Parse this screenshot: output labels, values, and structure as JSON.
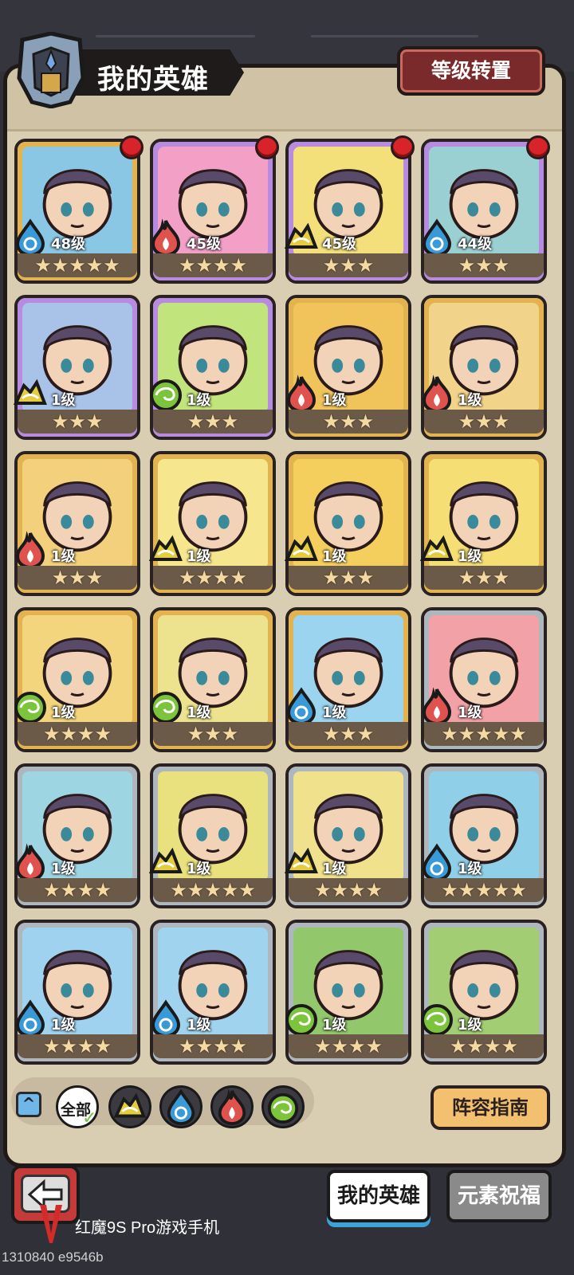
{
  "header": {
    "title": "我的英雄",
    "reset_button": "等级转置"
  },
  "heroes": [
    {
      "element": "water",
      "level": "48级",
      "stars": "★★★★★",
      "tier": "gold",
      "new": true,
      "color": "#8ac7e4"
    },
    {
      "element": "fire",
      "level": "45级",
      "stars": "★★★★",
      "tier": "purple",
      "new": true,
      "color": "#f3a0c6"
    },
    {
      "element": "earth",
      "level": "45级",
      "stars": "★★★",
      "tier": "purple",
      "new": true,
      "color": "#f4e07a"
    },
    {
      "element": "water",
      "level": "44级",
      "stars": "★★★",
      "tier": "purple",
      "new": true,
      "color": "#9bd0d2"
    },
    {
      "element": "earth",
      "level": "1级",
      "stars": "★★★",
      "tier": "purple",
      "new": false,
      "color": "#a9c2e7"
    },
    {
      "element": "wind",
      "level": "1级",
      "stars": "★★★",
      "tier": "purple",
      "new": false,
      "color": "#c2e47c"
    },
    {
      "element": "fire",
      "level": "1级",
      "stars": "★★★",
      "tier": "gold",
      "new": false,
      "color": "#f1c45b"
    },
    {
      "element": "fire",
      "level": "1级",
      "stars": "★★★",
      "tier": "gold",
      "new": false,
      "color": "#f2d38a"
    },
    {
      "element": "fire",
      "level": "1级",
      "stars": "★★★",
      "tier": "gold",
      "new": false,
      "color": "#f3d07c"
    },
    {
      "element": "earth",
      "level": "1级",
      "stars": "★★★★",
      "tier": "gold",
      "new": false,
      "color": "#f6e78e"
    },
    {
      "element": "earth",
      "level": "1级",
      "stars": "★★★",
      "tier": "gold",
      "new": false,
      "color": "#f4cf5e"
    },
    {
      "element": "earth",
      "level": "1级",
      "stars": "★★★",
      "tier": "gold",
      "new": false,
      "color": "#f5df74"
    },
    {
      "element": "wind",
      "level": "1级",
      "stars": "★★★★",
      "tier": "gold",
      "new": false,
      "color": "#f3d57e"
    },
    {
      "element": "wind",
      "level": "1级",
      "stars": "★★★",
      "tier": "gold",
      "new": false,
      "color": "#ede38f"
    },
    {
      "element": "water",
      "level": "1级",
      "stars": "★★★",
      "tier": "gold",
      "new": false,
      "color": "#9ad4ee"
    },
    {
      "element": "fire",
      "level": "1级",
      "stars": "★★★★★",
      "tier": "silver",
      "new": false,
      "color": "#f2a2a6"
    },
    {
      "element": "fire",
      "level": "1级",
      "stars": "★★★★",
      "tier": "silver",
      "new": false,
      "color": "#9ed5e2"
    },
    {
      "element": "earth",
      "level": "1级",
      "stars": "★★★★★",
      "tier": "silver",
      "new": false,
      "color": "#e9e17e"
    },
    {
      "element": "earth",
      "level": "1级",
      "stars": "★★★★",
      "tier": "silver",
      "new": false,
      "color": "#f0e28c"
    },
    {
      "element": "water",
      "level": "1级",
      "stars": "★★★★★",
      "tier": "silver",
      "new": false,
      "color": "#8fd0e8"
    },
    {
      "element": "water",
      "level": "1级",
      "stars": "★★★★",
      "tier": "silver",
      "new": false,
      "color": "#9fd2ef"
    },
    {
      "element": "water",
      "level": "1级",
      "stars": "★★★★",
      "tier": "silver",
      "new": false,
      "color": "#a0d3ee"
    },
    {
      "element": "wind",
      "level": "1级",
      "stars": "★★★★",
      "tier": "silver",
      "new": false,
      "color": "#92c76c"
    },
    {
      "element": "wind",
      "level": "1级",
      "stars": "★★★★",
      "tier": "silver",
      "new": false,
      "color": "#a3cd72"
    }
  ],
  "filters": {
    "all_label": "全部",
    "items": [
      "earth",
      "water",
      "fire",
      "wind"
    ]
  },
  "guide_button": "阵容指南",
  "tabs": {
    "my_heroes": "我的英雄",
    "element_blessing": "元素祝福"
  },
  "watermark": "红魔9S Pro游戏手机",
  "device_id": "1310840 e9546b",
  "colors": {
    "fire": "#e0524e",
    "water": "#3a9ad8",
    "earth": "#e4cc3c",
    "wind": "#7cc43c"
  }
}
